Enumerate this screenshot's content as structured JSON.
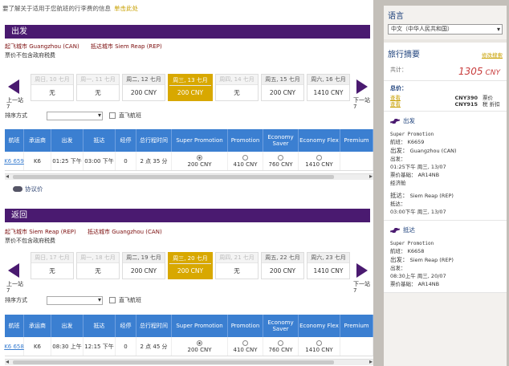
{
  "notice": {
    "text": "要了解关于适用于您航班的行李费的信息",
    "link": "单击此处"
  },
  "outbound": {
    "section_title": "出发",
    "origin": "起飞城市 Guangzhou (CAN)",
    "destination": "抵达城市 Siem Reap (REP)",
    "tax_note": "票价不包含政府税费",
    "dates": [
      {
        "label": "周日, 10 七月",
        "value": "无",
        "available": false,
        "selected": false
      },
      {
        "label": "周一, 11 七月",
        "value": "无",
        "available": false,
        "selected": false
      },
      {
        "label": "周二, 12 七月",
        "value": "200 CNY",
        "available": true,
        "selected": false
      },
      {
        "label": "周三, 13 七月",
        "value": "200 CNY",
        "available": true,
        "selected": true
      },
      {
        "label": "周四, 14 七月",
        "value": "无",
        "available": false,
        "selected": false
      },
      {
        "label": "周五, 15 七月",
        "value": "200 CNY",
        "available": true,
        "selected": false
      },
      {
        "label": "周六, 16 七月",
        "value": "1410 CNY",
        "available": true,
        "selected": false
      }
    ],
    "prev_label": "上一站 7",
    "next_label": "下一站 7",
    "flight": {
      "flight_no": "K6 659",
      "operator": "K6",
      "depart": "01:25 下午",
      "arrive": "03:00 下午",
      "stops": "0",
      "duration": "2 点 35 分",
      "fares": [
        "200 CNY",
        "410 CNY",
        "760 CNY",
        "1410 CNY"
      ],
      "selected_fare": 0
    },
    "agreement_label": "协议价"
  },
  "inbound": {
    "section_title": "返回",
    "origin": "起飞城市 Siem Reap (REP)",
    "destination": "抵达城市 Guangzhou (CAN)",
    "tax_note": "票价不包含政府税费",
    "dates": [
      {
        "label": "周日, 17 七月",
        "value": "无",
        "available": false,
        "selected": false
      },
      {
        "label": "周一, 18 七月",
        "value": "无",
        "available": false,
        "selected": false
      },
      {
        "label": "周二, 19 七月",
        "value": "200 CNY",
        "available": true,
        "selected": false
      },
      {
        "label": "周三, 20 七月",
        "value": "200 CNY",
        "available": true,
        "selected": true
      },
      {
        "label": "周四, 21 七月",
        "value": "无",
        "available": false,
        "selected": false
      },
      {
        "label": "周五, 22 七月",
        "value": "200 CNY",
        "available": true,
        "selected": false
      },
      {
        "label": "周六, 23 七月",
        "value": "1410 CNY",
        "available": true,
        "selected": false
      }
    ],
    "prev_label": "上一站 7",
    "next_label": "下一站 7",
    "flight": {
      "flight_no": "K6 658",
      "operator": "K6",
      "depart": "08:30 上午",
      "arrive": "12:15 下午",
      "stops": "0",
      "duration": "2 点 45 分",
      "fares": [
        "200 CNY",
        "410 CNY",
        "760 CNY",
        "1410 CNY"
      ],
      "selected_fare": 0
    }
  },
  "sort": {
    "label": "排序方式",
    "direct_label": "直飞航班"
  },
  "table_headers": [
    "航班",
    "承运商",
    "出发",
    "抵达",
    "经停",
    "总行程时间",
    "Super Promotion",
    "Promotion",
    "Economy Saver",
    "Economy Flex",
    "Premium"
  ],
  "sidebar": {
    "lang_title": "语言",
    "lang_value": "中文（中华人民共和国）",
    "summary_title": "旅行摘要",
    "summary_link": "修改搜索",
    "total_label": "共计：",
    "total_value": "1305",
    "total_currency": "CNY",
    "price_label": "总价：",
    "price_rows": [
      {
        "link": "查看",
        "amount": "CNY390",
        "desc": "票价"
      },
      {
        "link": "查看",
        "amount": "CNY915",
        "desc": "税 折扣"
      }
    ],
    "out_leg": {
      "title": "出发",
      "fare": "Super Promotion",
      "flight": "航班： K6659",
      "depart_label": "出发：",
      "depart_city": "Guangzhou (CAN)",
      "depart_time_label": "出发：",
      "depart_time": "01:25下午 周三, 13/07",
      "base_label": "票价基础：",
      "base": "AR14NB",
      "cabin": "经济舱",
      "arrive_label": "抵达：",
      "arrive_city": "Siem Reap (REP)",
      "arrive_time_label": "抵达：",
      "arrive_time": "03:00下午 周三, 13/07"
    },
    "in_leg": {
      "title": "抵达",
      "fare": "Super Promotion",
      "flight": "航班： K6658",
      "depart_label": "出发：",
      "depart_city": "Siem Reap (REP)",
      "depart_time_label": "出发：",
      "depart_time": "08:30上午 周三, 20/07",
      "base_label": "票价基础：",
      "base": "AR14NB"
    }
  },
  "colors": {
    "purple": "#4a1a70",
    "gold": "#d8a800",
    "blue": "#3b7fd1"
  }
}
